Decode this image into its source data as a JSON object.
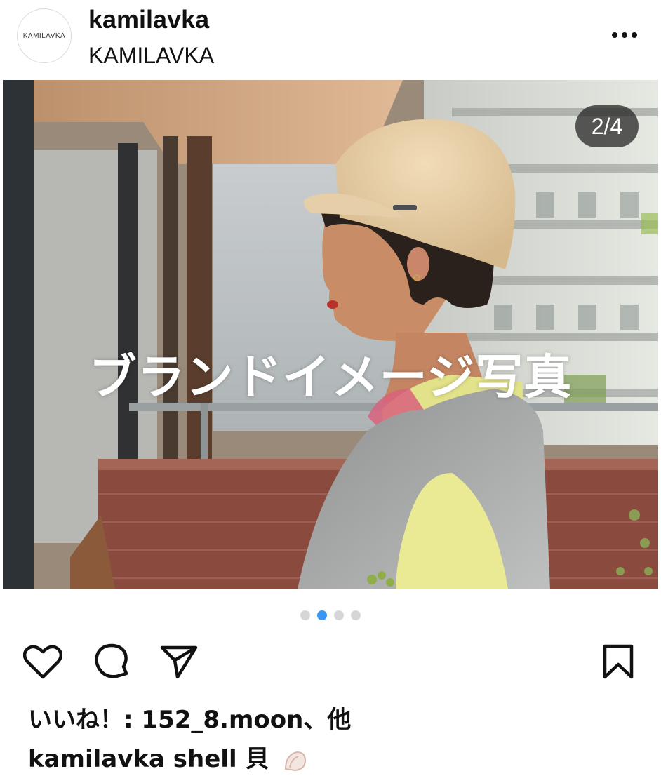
{
  "header": {
    "username": "kamilavka",
    "subtitle": "KAMILAVKA",
    "avatar_logo_text": "KAMILAVKA",
    "more_icon": "more-horizontal-icon"
  },
  "post": {
    "image_counter": "2/4",
    "overlay_text": "ブランドイメージ写真",
    "current_slide": 2,
    "total_slides": 4
  },
  "actions": {
    "like_icon": "heart-icon",
    "comment_icon": "comment-icon",
    "share_icon": "paper-plane-icon",
    "save_icon": "bookmark-icon"
  },
  "caption": {
    "likes_text": "いいね！: 152_8.moon、他",
    "caption_username": "kamilavka",
    "caption_text": "shell 貝",
    "emoji_icon": "shell-emoji-icon"
  },
  "colors": {
    "accent_dot": "#3897f0",
    "inactive_dot": "#d6d6d6",
    "badge_bg": "#1e1e1e"
  }
}
